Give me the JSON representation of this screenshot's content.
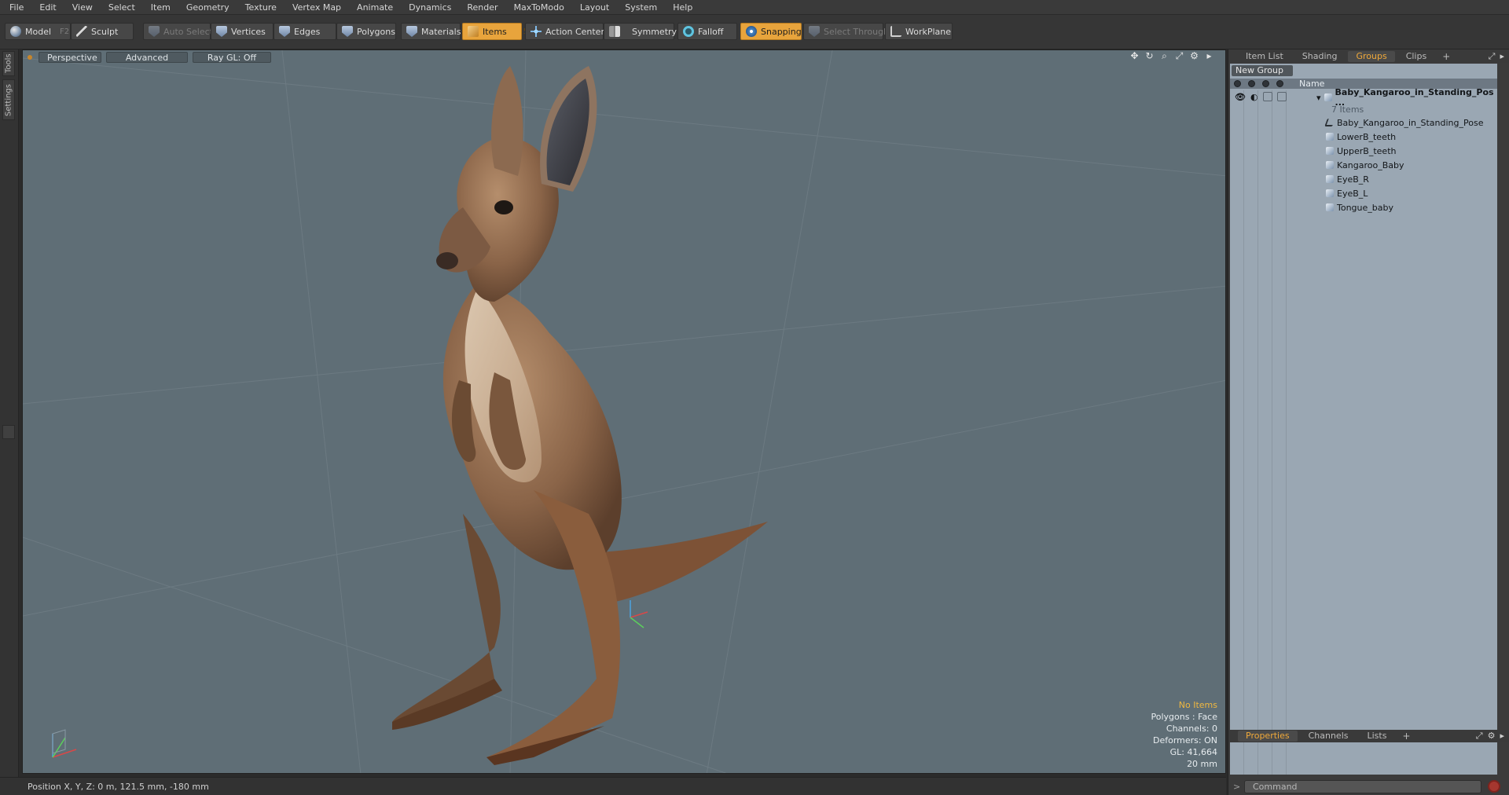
{
  "menu": [
    "File",
    "Edit",
    "View",
    "Select",
    "Item",
    "Geometry",
    "Texture",
    "Vertex Map",
    "Animate",
    "Dynamics",
    "Render",
    "MaxToModo",
    "Layout",
    "System",
    "Help"
  ],
  "toolbar": {
    "model": {
      "label": "Model",
      "key": "F2",
      "icon": "sphere-icon"
    },
    "sculpt": {
      "label": "Sculpt",
      "icon": "brush-icon"
    },
    "auto_select": {
      "label": "Auto Select",
      "icon": "shield-icon"
    },
    "vertices": {
      "label": "Vertices",
      "key": "1",
      "icon": "shield-icon"
    },
    "edges": {
      "label": "Edges",
      "key": "2",
      "icon": "shield-icon"
    },
    "polygons": {
      "label": "Polygons",
      "icon": "shield-icon"
    },
    "materials": {
      "label": "Materials",
      "icon": "shield-icon"
    },
    "items": {
      "label": "Items",
      "key": "5",
      "icon": "box-icon"
    },
    "action_center": {
      "label": "Action Center",
      "icon": "crosshair-icon"
    },
    "symmetry": {
      "label": "Symmetry",
      "icon": "symmetry-icon"
    },
    "falloff": {
      "label": "Falloff",
      "icon": "falloff-icon"
    },
    "snapping": {
      "label": "Snapping",
      "icon": "snapping-icon"
    },
    "select_through": {
      "label": "Select Through",
      "icon": "select-through-icon"
    },
    "workplane": {
      "label": "WorkPlane",
      "icon": "workplane-icon"
    }
  },
  "left_tabs": [
    "Tools",
    "Settings"
  ],
  "viewport": {
    "view_label": "Perspective",
    "shading_label": "Advanced",
    "raygl_label": "Ray GL: Off",
    "info": {
      "items": "No Items",
      "polygons": "Polygons : Face",
      "channels": "Channels: 0",
      "deformers": "Deformers: ON",
      "gl": "GL: 41,664",
      "scale": "20 mm"
    }
  },
  "status": {
    "position": "Position X, Y, Z:  0 m, 121.5 mm, -180 mm"
  },
  "right_panel": {
    "tabs": [
      "Item List",
      "Shading",
      "Groups",
      "Clips"
    ],
    "active_tab": "Groups",
    "new_group_label": "New Group",
    "name_column": "Name",
    "root_group": {
      "label": "Baby_Kangaroo_in_Standing_Pos ...",
      "count": "7 Items"
    },
    "items": [
      "Baby_Kangaroo_in_Standing_Pose",
      "LowerB_teeth",
      "UpperB_teeth",
      "Kangaroo_Baby",
      "EyeB_R",
      "EyeB_L",
      "Tongue_baby"
    ],
    "bottom_tabs": [
      "Properties",
      "Channels",
      "Lists"
    ],
    "active_bottom_tab": "Properties",
    "command_placeholder": "Command",
    "command_prompt": ">"
  },
  "colors": {
    "accent": "#e8a43c",
    "viewport_bg": "#5f6e76",
    "panel_bg": "#9aa7b3"
  }
}
